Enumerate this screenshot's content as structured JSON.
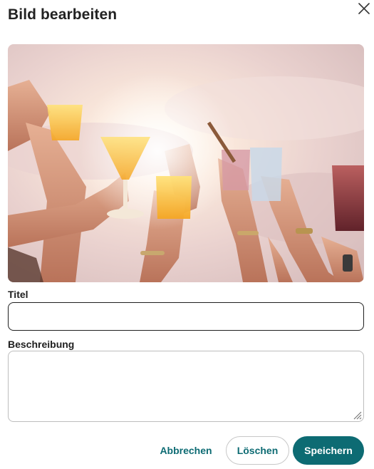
{
  "dialog": {
    "title": "Bild bearbeiten",
    "close_icon": "close-icon"
  },
  "image": {
    "description_icon": "party-drinks-photo"
  },
  "fields": {
    "title_label": "Titel",
    "title_value": "",
    "description_label": "Beschreibung",
    "description_value": ""
  },
  "actions": {
    "cancel_label": "Abbrechen",
    "delete_label": "Löschen",
    "save_label": "Speichern"
  },
  "colors": {
    "accent": "#0d6b73",
    "text": "#1f1f1f",
    "border": "#bdbdbd"
  }
}
